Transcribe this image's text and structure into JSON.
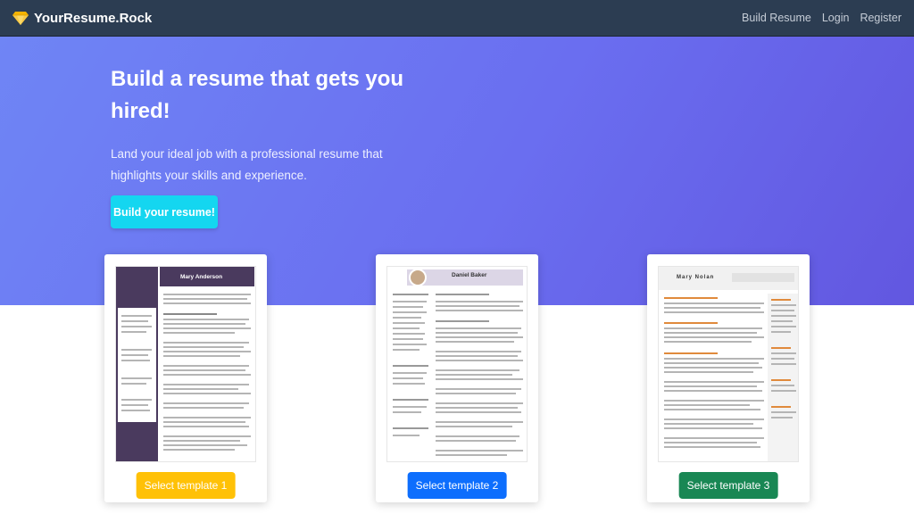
{
  "navbar": {
    "brand": "YourResume.Rock",
    "brand_icon": "gem-icon",
    "links": [
      "Build Resume",
      "Login",
      "Register"
    ]
  },
  "hero": {
    "title": "Build a resume that gets you hired!",
    "subtitle": "Land your ideal job with a professional resume that highlights your skills and experience.",
    "cta": "Build your resume!"
  },
  "templates": [
    {
      "button": "Select template 1",
      "name": "Mary Anderson",
      "color": "#ffc107"
    },
    {
      "button": "Select template 2",
      "name": "Daniel Baker",
      "color": "#0d6efd"
    },
    {
      "button": "Select template 3",
      "name": "Mary Nolan",
      "color": "#198754"
    }
  ],
  "colors": {
    "navbar": "#2c3d52",
    "hero_gradient_start": "#6f85f5",
    "hero_gradient_end": "#6257e0",
    "cta": "#14d6f0"
  }
}
